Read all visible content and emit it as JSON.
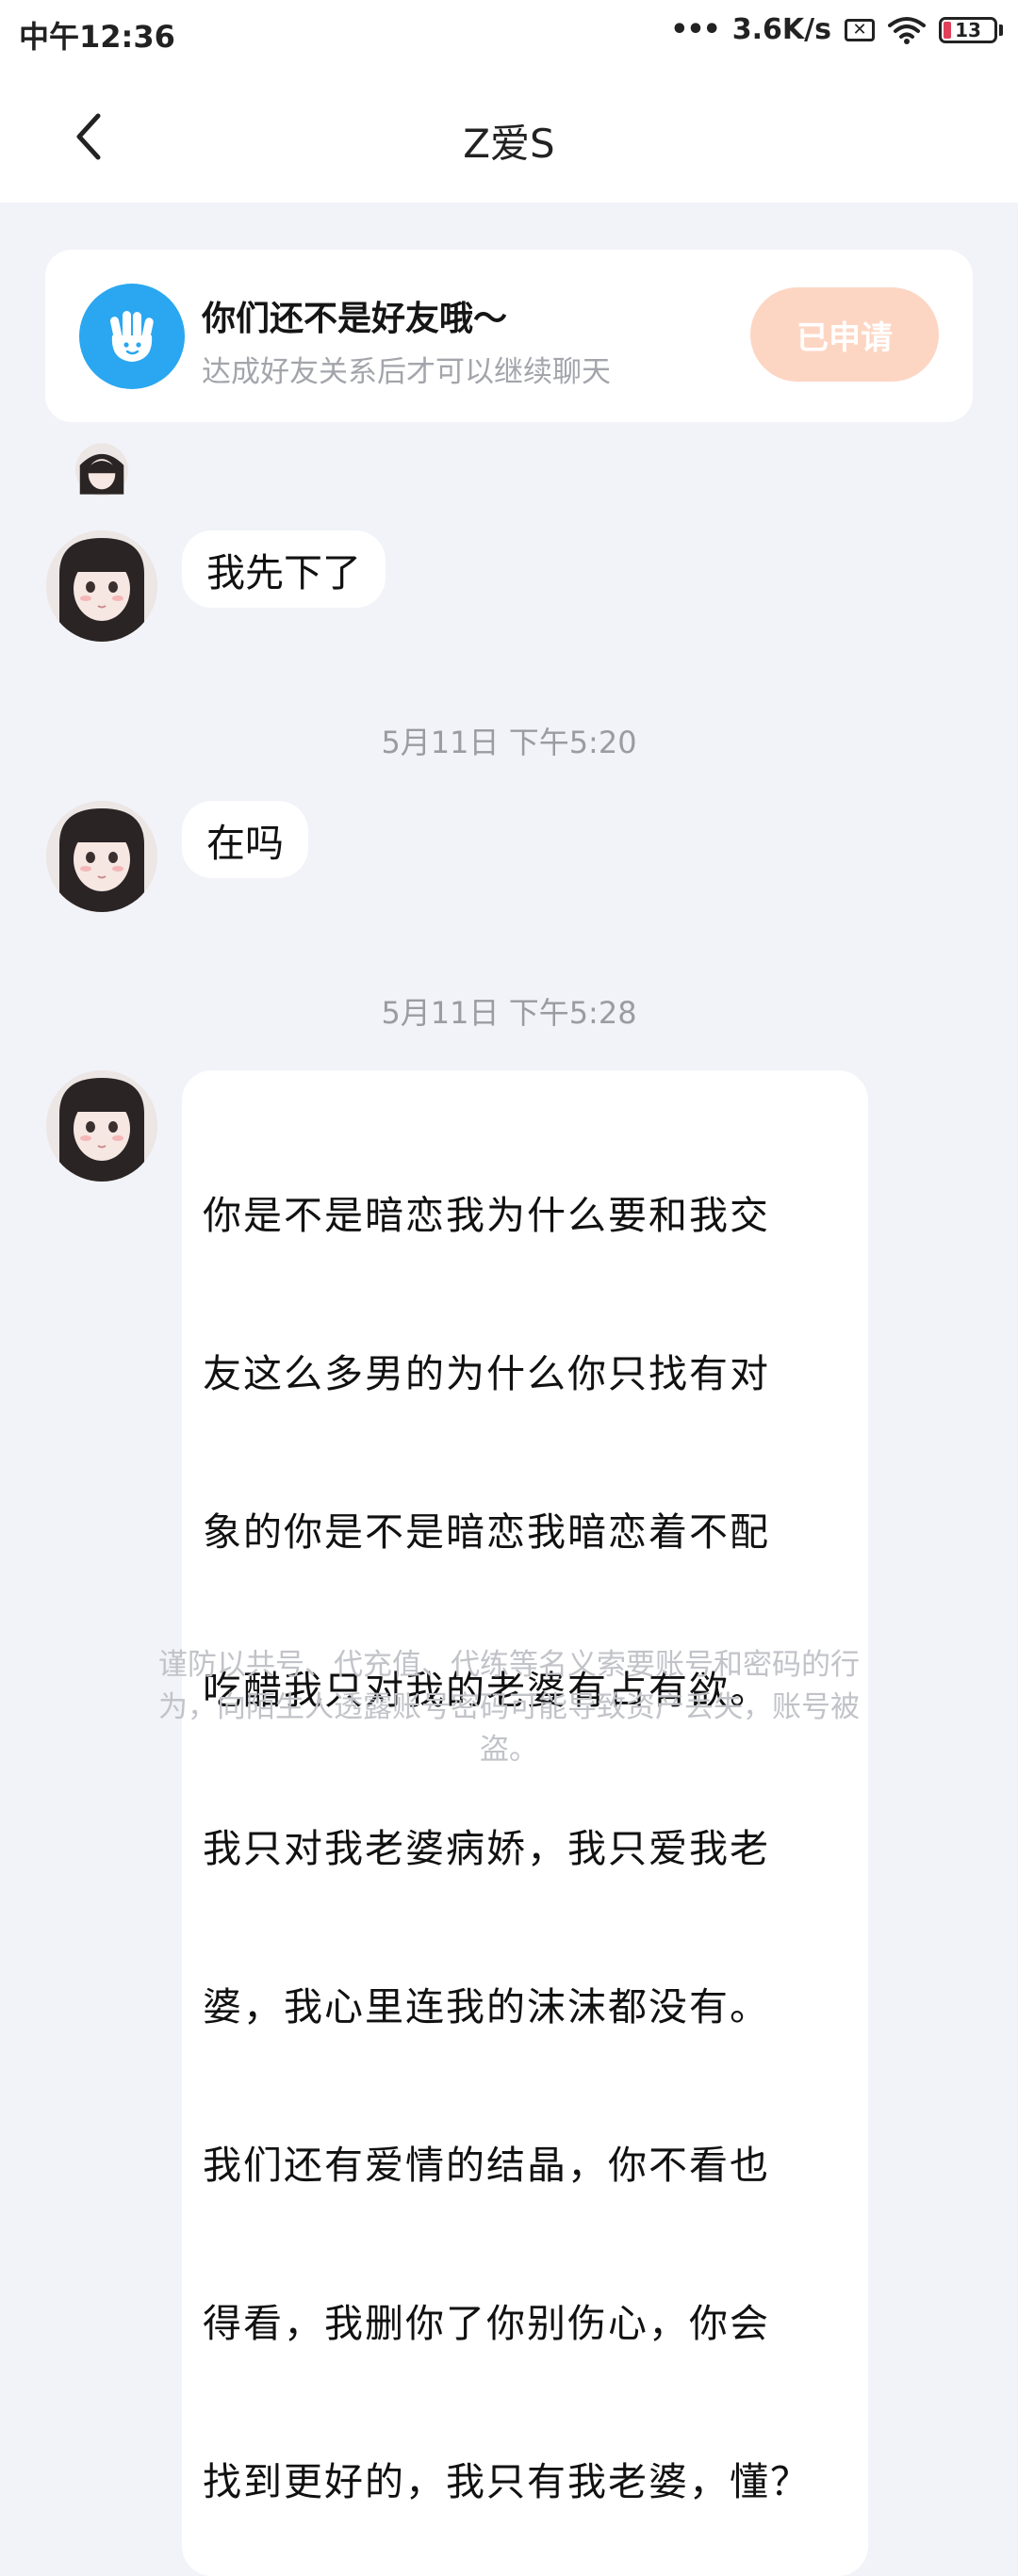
{
  "status_bar": {
    "time": "中午12:36",
    "network_speed": "3.6K/s",
    "battery_level": "13",
    "dots": "•••"
  },
  "header": {
    "title": "Z爱S"
  },
  "friend_notice": {
    "title": "你们还不是好友哦～",
    "subtitle": "达成好友关系后才可以继续聊天",
    "button_label": "已申请",
    "icon": "waving-hand-icon",
    "colors": {
      "icon_bg": "#2aa7f0",
      "button_bg": "#fdd6c3"
    }
  },
  "messages": [
    {
      "text": "我先下了"
    },
    {
      "timestamp": "5月11日 下午5:20"
    },
    {
      "text": "在吗"
    },
    {
      "timestamp": "5月11日 下午5:28"
    },
    {
      "lines": [
        "你是不是暗恋我为什么要和我交",
        "友这么多男的为什么你只找有对",
        "象的你是不是暗恋我暗恋着不配",
        "吃醋我只对我的老婆有占有欲。",
        "我只对我老婆病娇，我只爱我老",
        "婆，我心里连我的沫沫都没有。",
        "我们还有爱情的结晶，你不看也",
        "得看，我删你了你别伤心，你会",
        "找到更好的，我只有我老婆，懂？"
      ]
    }
  ],
  "footer": {
    "warning_lines": [
      "谨防以共号、代充值、代练等名义索要账号和密码的行",
      "为，向陌生人透露账号密码可能导致资产丢失，账号被",
      "盗。"
    ]
  }
}
